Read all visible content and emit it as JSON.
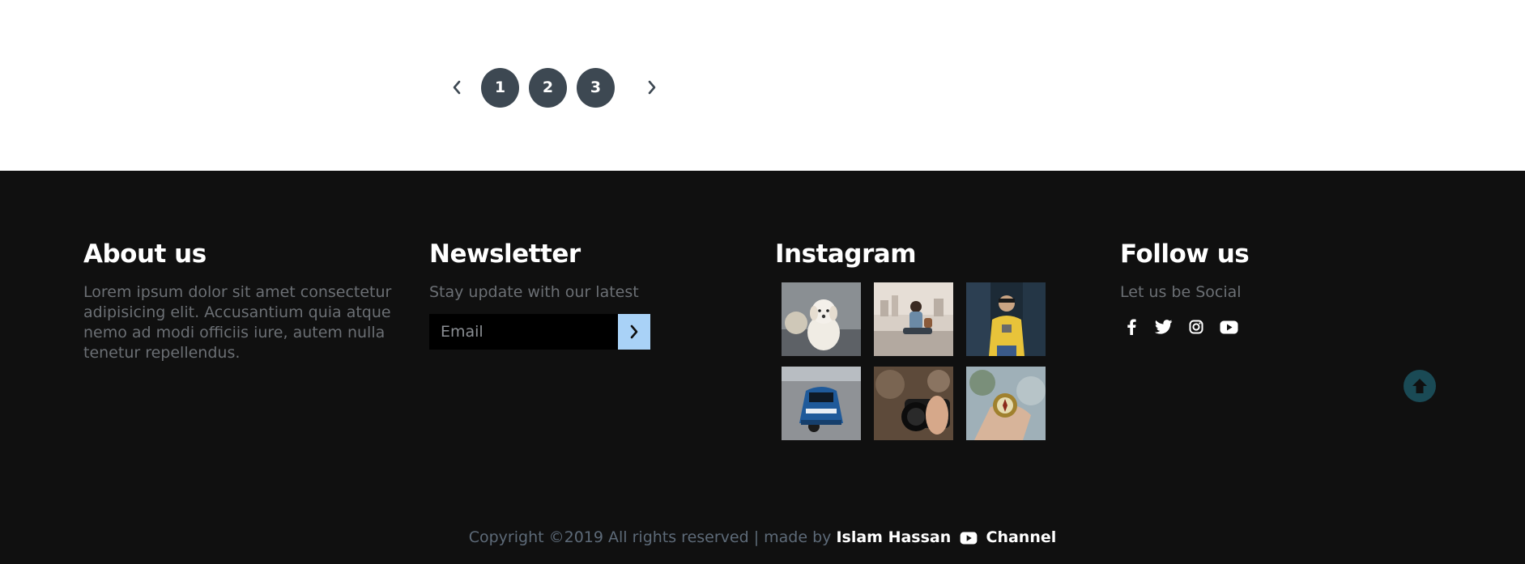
{
  "pagination": {
    "pages": [
      "1",
      "2",
      "3"
    ],
    "prev_icon": "chevron-left-icon",
    "next_icon": "chevron-right-icon"
  },
  "about": {
    "title": "About us",
    "text": "Lorem ipsum dolor sit amet consectetur adipisicing elit. Accusantium quia atque nemo ad modi officiis iure, autem nulla tenetur repellendus."
  },
  "newsletter": {
    "title": "Newsletter",
    "text": "Stay update with our latest",
    "email_placeholder": "Email",
    "submit_icon": "chevron-right-icon"
  },
  "instagram": {
    "title": "Instagram",
    "images": [
      "dog-photo",
      "woman-city-photo",
      "man-yellow-sweater-photo",
      "blue-car-photo",
      "camera-photo",
      "compass-photo"
    ]
  },
  "follow": {
    "title": "Follow us",
    "text": "Let us be Social",
    "icons": [
      "facebook-icon",
      "twitter-icon",
      "instagram-icon",
      "youtube-icon"
    ]
  },
  "copyright": {
    "prefix": "Copyright ©2019 All rights reserved | made by",
    "author": "Islam Hassan",
    "suffix": "Channel"
  },
  "colors": {
    "footer_bg": "#101010",
    "page_button": "#3d4852",
    "newsletter_button": "#a9d2f7",
    "back_to_top": "#1a4a55",
    "muted_text": "#6b6f74"
  }
}
